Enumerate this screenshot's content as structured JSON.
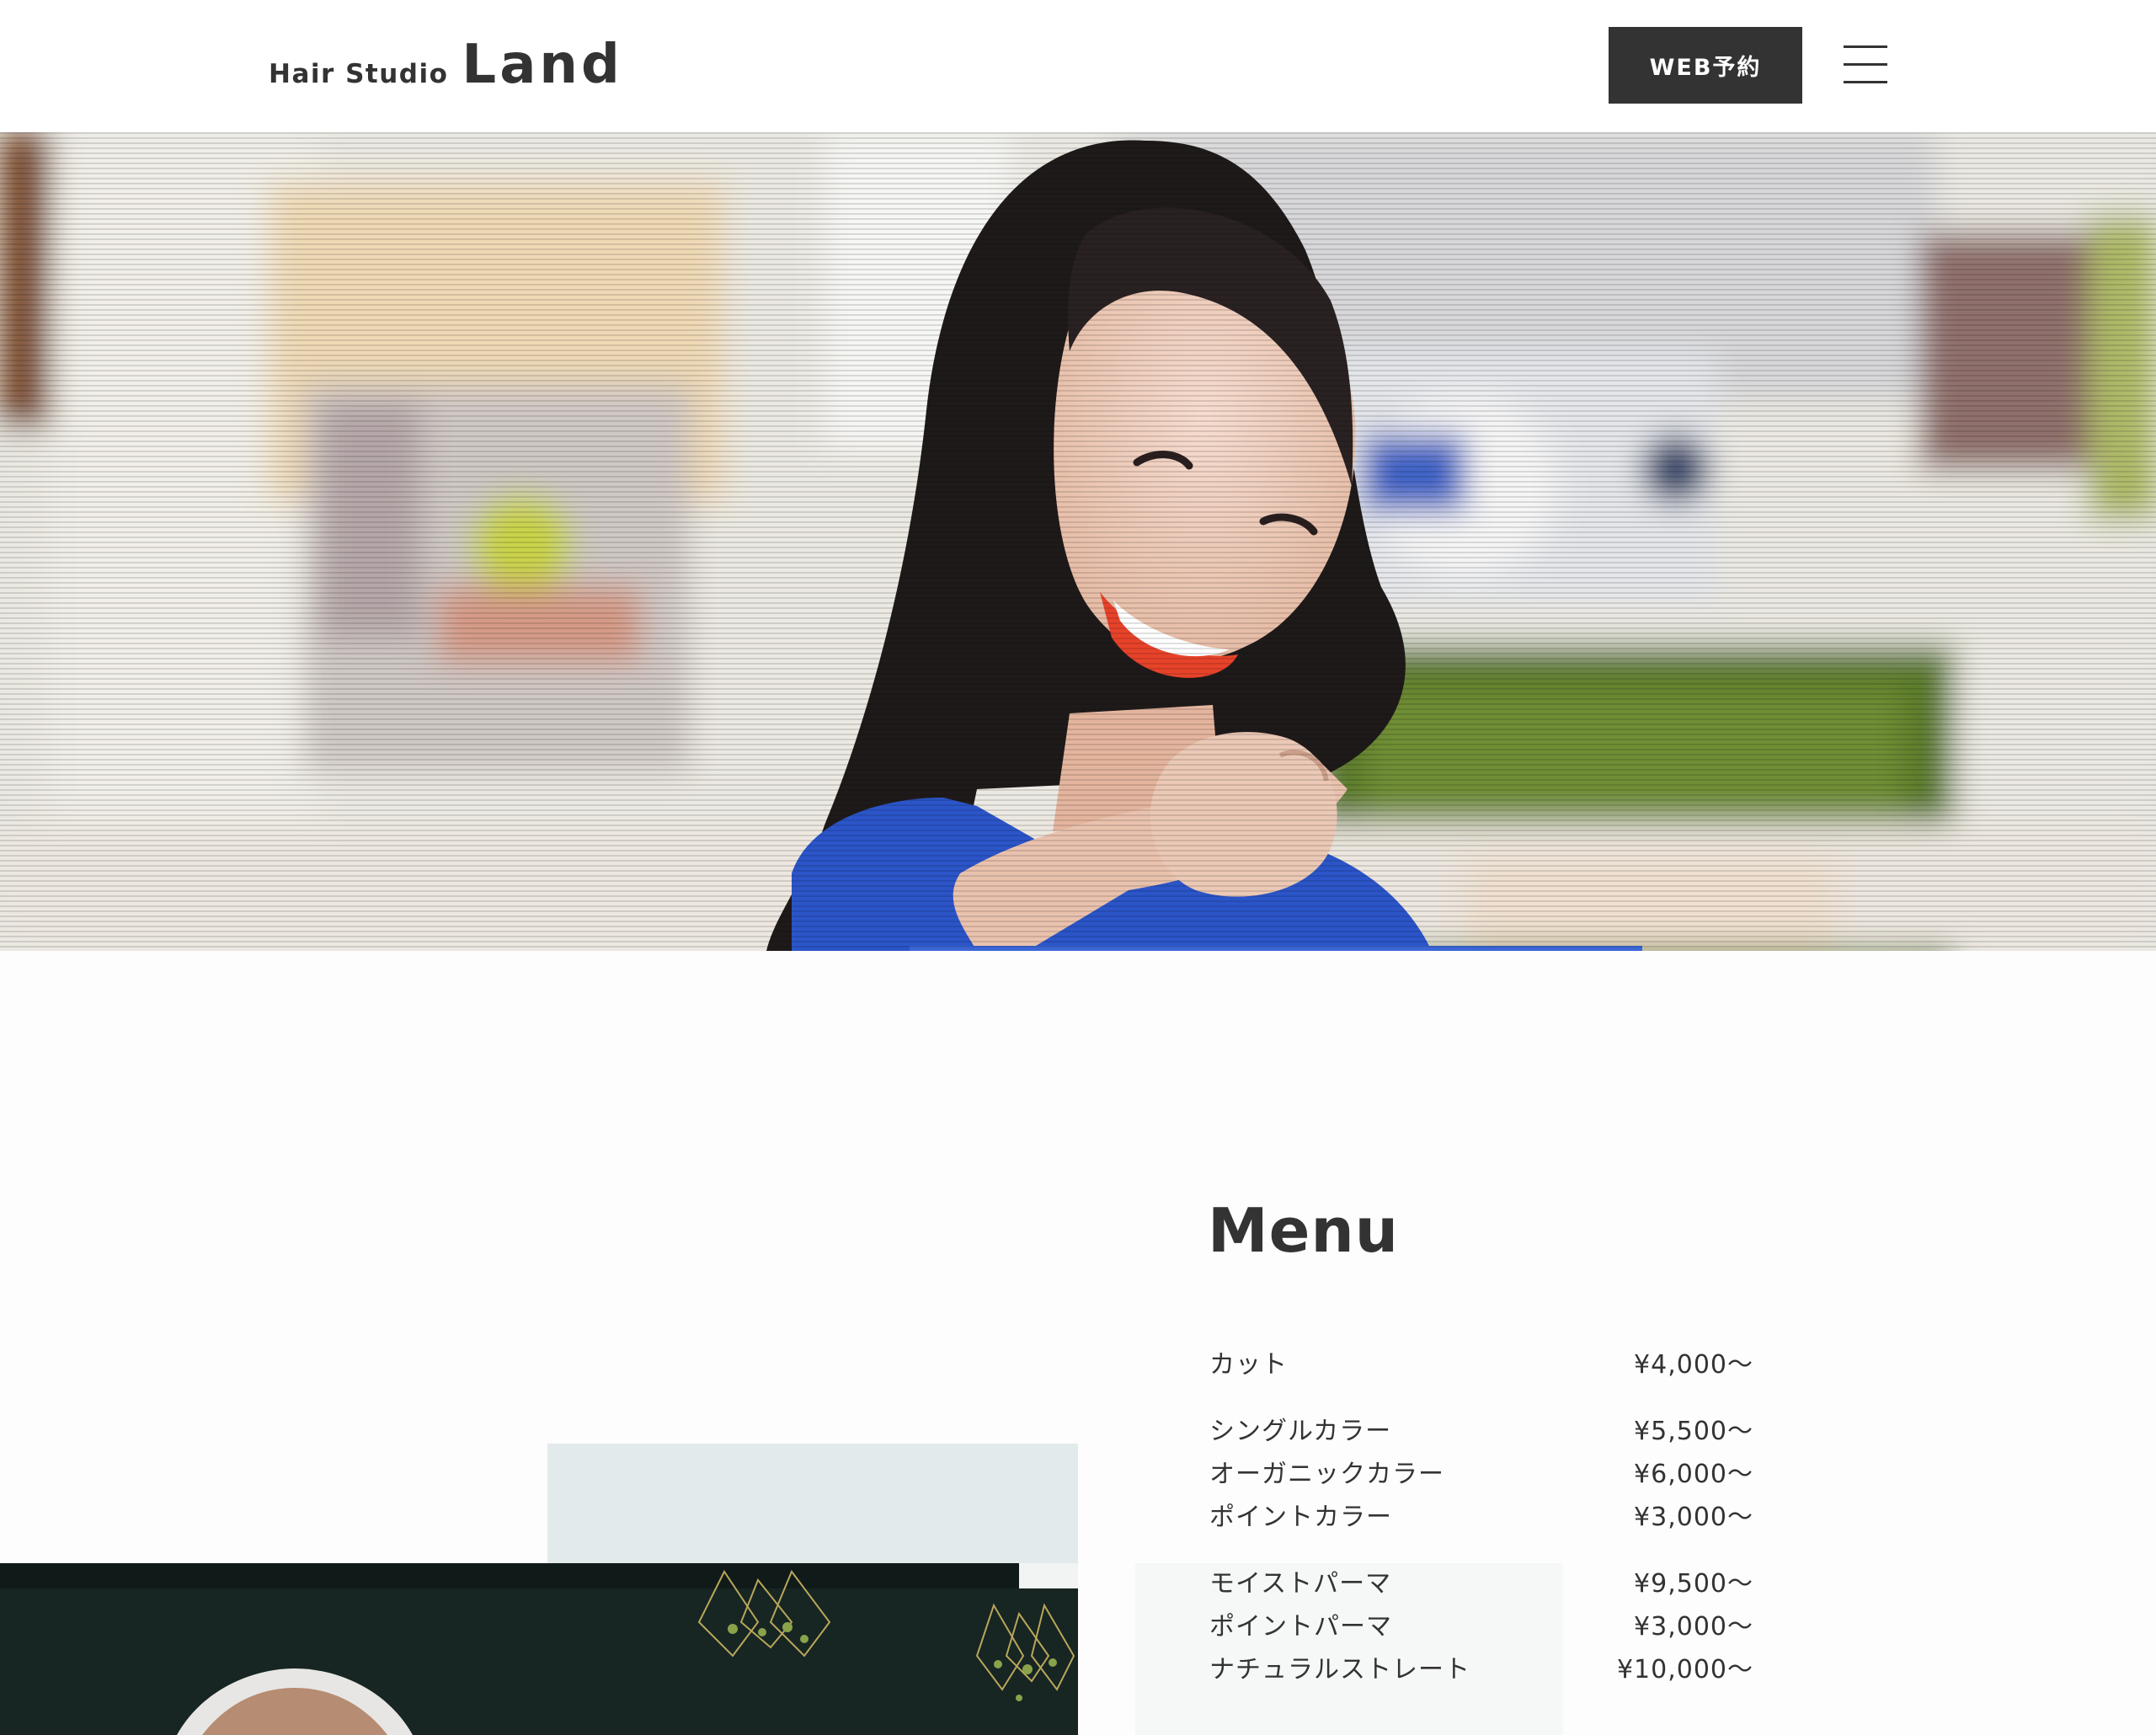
{
  "header": {
    "logo_small": "Hair Studio",
    "logo_big": "Land",
    "reserve_button": "WEB予約"
  },
  "hero": {
    "image_alt": "smiling woman reaching out hand"
  },
  "menu": {
    "title": "Menu",
    "groups": [
      {
        "items": [
          {
            "name": "カット",
            "price": "¥4,000〜"
          }
        ]
      },
      {
        "items": [
          {
            "name": "シングルカラー",
            "price": "¥5,500〜"
          },
          {
            "name": "オーガニックカラー",
            "price": "¥6,000〜"
          },
          {
            "name": "ポイントカラー",
            "price": "¥3,000〜"
          }
        ]
      },
      {
        "items": [
          {
            "name": "モイストパーマ",
            "price": "¥9,500〜"
          },
          {
            "name": "ポイントパーマ",
            "price": "¥3,000〜"
          },
          {
            "name": "ナチュラルストレート",
            "price": "¥10,000〜"
          }
        ]
      }
    ]
  },
  "colors": {
    "text": "#333333",
    "button_bg": "#333333",
    "button_text": "#ffffff",
    "light_block": "#e3eaeb",
    "salon_dark": "#162422",
    "dress_blue": "#2b55c8"
  }
}
